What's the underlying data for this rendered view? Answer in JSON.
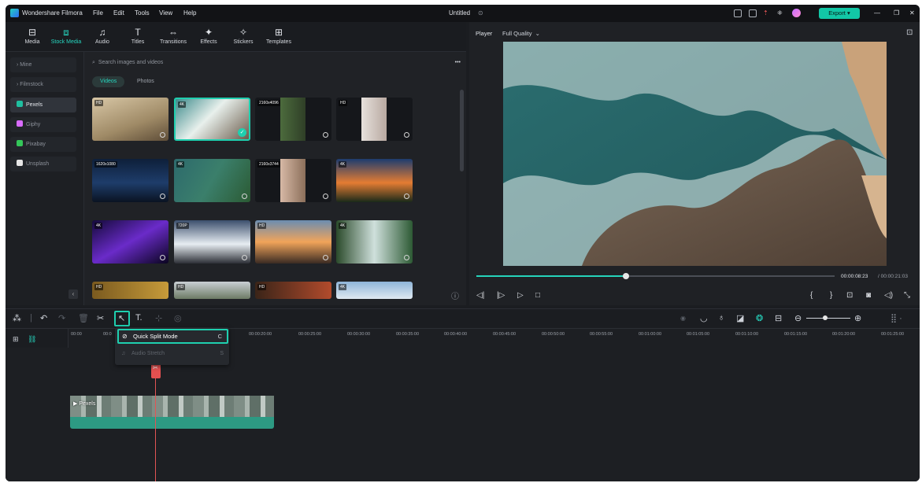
{
  "app": {
    "name": "Wondershare Filmora",
    "menu": [
      "File",
      "Edit",
      "Tools",
      "View",
      "Help"
    ],
    "project_title": "Untitled",
    "export_label": "Export"
  },
  "toolbar": {
    "items": [
      {
        "label": "Media",
        "icon": "media-icon"
      },
      {
        "label": "Stock Media",
        "icon": "stock-media-icon",
        "active": true
      },
      {
        "label": "Audio",
        "icon": "audio-icon"
      },
      {
        "label": "Titles",
        "icon": "titles-icon"
      },
      {
        "label": "Transitions",
        "icon": "transitions-icon"
      },
      {
        "label": "Effects",
        "icon": "effects-icon"
      },
      {
        "label": "Stickers",
        "icon": "stickers-icon"
      },
      {
        "label": "Templates",
        "icon": "templates-icon"
      }
    ]
  },
  "sidebar": {
    "items": [
      {
        "label": "Mine"
      },
      {
        "label": "Filmstock"
      },
      {
        "label": "Pexels",
        "selected": true
      },
      {
        "label": "Giphy"
      },
      {
        "label": "Pixabay"
      },
      {
        "label": "Unsplash"
      }
    ]
  },
  "search": {
    "placeholder": "Search images and videos"
  },
  "filters": {
    "videos": "Videos",
    "photos": "Photos"
  },
  "thumbnails": [
    {
      "badge": "HD"
    },
    {
      "badge": "4K"
    },
    {
      "badge": "2160x4096"
    },
    {
      "badge": "HD"
    },
    {
      "badge": "1620x1080"
    },
    {
      "badge": "4K"
    },
    {
      "badge": "2160x3744"
    },
    {
      "badge": "4K"
    },
    {
      "badge": "4K"
    },
    {
      "badge": "720P"
    },
    {
      "badge": "HD"
    },
    {
      "badge": "4K"
    },
    {
      "badge": "HD"
    },
    {
      "badge": "HD"
    },
    {
      "badge": "HD"
    },
    {
      "badge": "4K"
    }
  ],
  "player": {
    "label": "Player",
    "quality": "Full Quality",
    "current_time": "00:00:08:23",
    "total_time": "/ 00:00:21:03",
    "progress": 0.41
  },
  "timeline": {
    "ruler": [
      "00:00",
      "00:0",
      "00:00:20:00",
      "00:00:25:00",
      "00:00:30:00",
      "00:00:35:00",
      "00:00:40:00",
      "00:00:45:00",
      "00:00:50:00",
      "00:00:55:00",
      "00:01:00:00",
      "00:01:05:00",
      "00:01:10:00",
      "00:01:15:00",
      "00:01:20:00",
      "00:01:25:00"
    ],
    "clip_label": "Pexels",
    "dropdown": {
      "quick_split": "Quick Split Mode",
      "quick_split_key": "C",
      "audio_stretch": "Audio Stretch",
      "audio_stretch_key": "S"
    },
    "video_track": "1",
    "audio_track": "1"
  }
}
